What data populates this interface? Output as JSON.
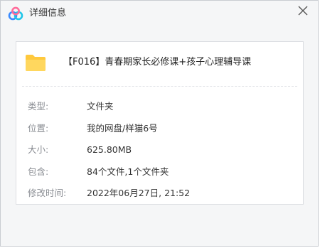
{
  "window": {
    "title": "详细信息",
    "logo_icon": "cloud-logo-icon",
    "close_icon": "close-icon"
  },
  "file": {
    "icon": "folder-icon",
    "name": "【F016】青春期家长必修课+孩子心理辅导课"
  },
  "properties": [
    {
      "label": "类型:",
      "value": "文件夹"
    },
    {
      "label": "位置:",
      "value": "我的网盘/样猫6号"
    },
    {
      "label": "大小:",
      "value": "625.80MB"
    },
    {
      "label": "包含:",
      "value": "84个文件,1个文件夹"
    },
    {
      "label": "修改时间:",
      "value": "2022年06月27日, 21:52"
    }
  ],
  "colors": {
    "window_bg": "#f5f6f7",
    "panel_bg": "#ffffff",
    "label_text": "#8a8d93",
    "value_text": "#333333",
    "folder_yellow": "#ffc93d",
    "logo_blue": "#3a8bff",
    "logo_pink": "#ff6b9a"
  }
}
